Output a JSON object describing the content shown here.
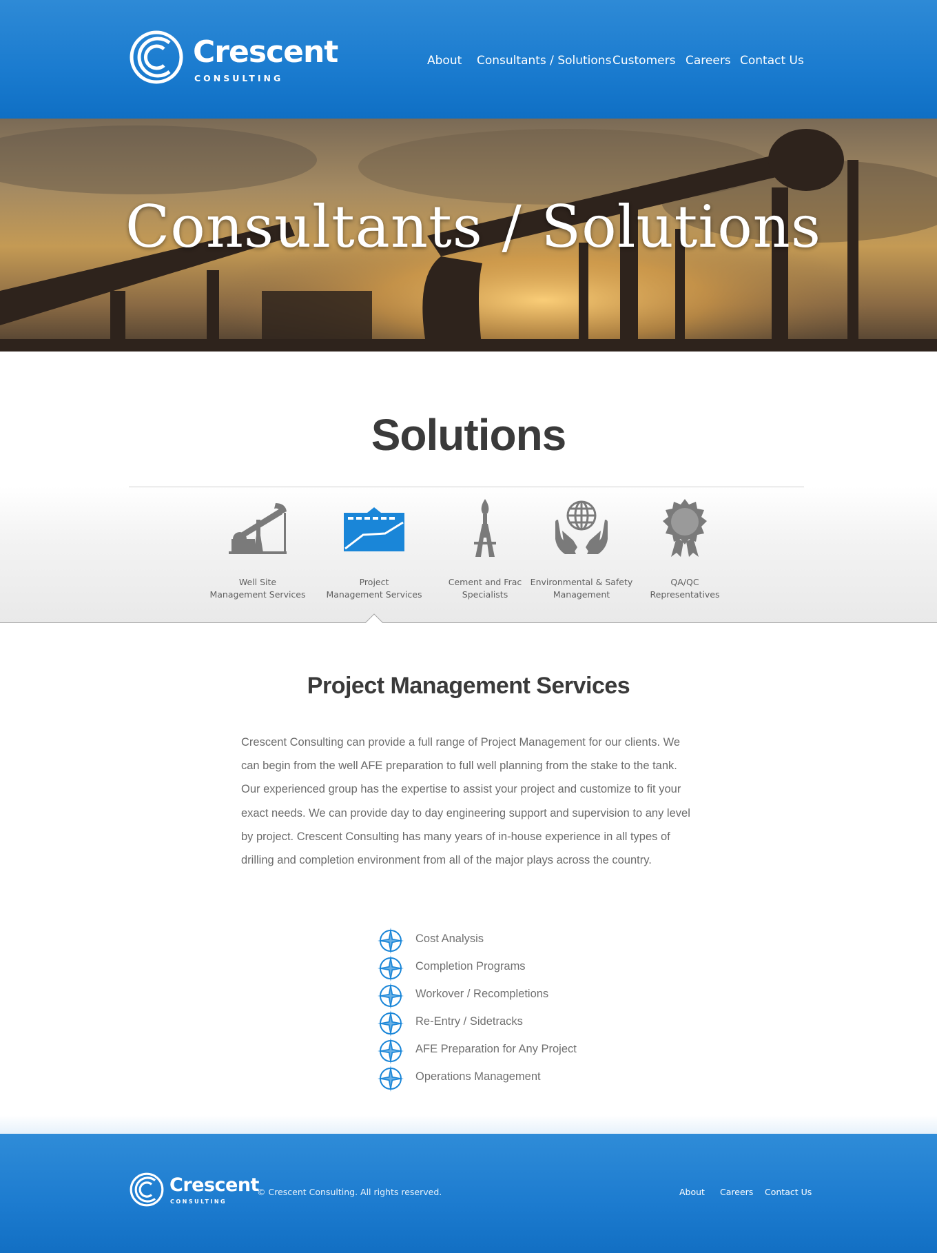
{
  "brand": {
    "name": "Crescent",
    "tagline": "CONSULTING"
  },
  "nav": {
    "items": [
      "About",
      "Consultants / Solutions",
      "Customers",
      "Careers",
      "Contact Us"
    ]
  },
  "hero": {
    "title": "Consultants / Solutions"
  },
  "solutions": {
    "title": "Solutions",
    "tabs": [
      {
        "line1": "Well Site",
        "line2": "Management Services",
        "icon": "pumpjack-icon",
        "active": false
      },
      {
        "line1": "Project",
        "line2": "Management Services",
        "icon": "project-chart-icon",
        "active": true
      },
      {
        "line1": "Cement and Frac",
        "line2": "Specialists",
        "icon": "rig-flame-icon",
        "active": false
      },
      {
        "line1": "Environmental & Safety",
        "line2": "Management",
        "icon": "globe-hands-icon",
        "active": false
      },
      {
        "line1": "QA/QC",
        "line2": "Representatives",
        "icon": "award-ribbon-icon",
        "active": false
      }
    ]
  },
  "section": {
    "title": "Project Management Services",
    "body": "Crescent Consulting can provide a full range of Project Management for our clients. We can begin from the well AFE preparation to full well planning from the stake to the tank. Our experienced group has the expertise to assist your project and customize to fit your exact needs. We can provide day to day engineering support and supervision to any level by project. Crescent Consulting has many years of in-house experience in all types of drilling and completion environment from all of the major plays across the country.",
    "services": [
      "Cost Analysis",
      "Completion Programs",
      "Workover / Recompletions",
      "Re-Entry / Sidetracks",
      "AFE Preparation for Any Project",
      "Operations Management"
    ]
  },
  "footer": {
    "copyright": "© Crescent Consulting. All rights reserved.",
    "links": [
      "About",
      "Careers",
      "Contact Us"
    ]
  },
  "colors": {
    "brand_blue": "#1a7bcf",
    "active_icon": "#1a86d8",
    "icon_gray": "#7a7a7a",
    "heading": "#3a3a3a"
  }
}
